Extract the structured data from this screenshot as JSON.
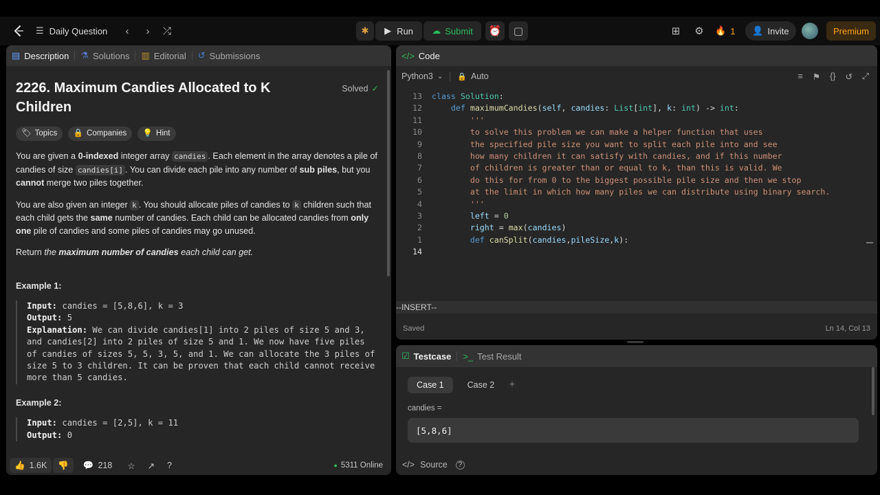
{
  "topbar": {
    "nav_label": "Daily Question",
    "run_label": "Run",
    "submit_label": "Submit",
    "streak_count": "1",
    "invite_label": "Invite",
    "premium_label": "Premium"
  },
  "desc": {
    "tabs": [
      "Description",
      "Solutions",
      "Editorial",
      "Submissions"
    ],
    "title": "2226. Maximum Candies Allocated to K Children",
    "status": "Solved",
    "chips": [
      "Topics",
      "Companies",
      "Hint"
    ],
    "p1": {
      "a": "You are given a ",
      "b": "0-indexed",
      "c": " integer array ",
      "code1": "candies",
      "d": ". Each element in the array denotes a pile of candies of size ",
      "code2": "candies[i]",
      "e": ". You can divide each pile into any number of ",
      "f": "sub piles",
      "g": ", but you ",
      "h": "cannot",
      "i": " merge two piles together."
    },
    "p2": {
      "a": "You are also given an integer ",
      "code1": "k",
      "b": ". You should allocate piles of candies to ",
      "code2": "k",
      "c": " children such that each child gets the ",
      "d": "same",
      "e": " number of candies. Each child can be allocated candies from ",
      "f": "only one",
      "g": " pile of candies and some piles of candies may go unused."
    },
    "p3": {
      "a": "Return ",
      "b": "the ",
      "c": "maximum number of candies",
      "d": " each child can get."
    },
    "example1": {
      "heading": "Example 1:",
      "input_label": "Input:",
      "input": "candies = [5,8,6], k = 3",
      "output_label": "Output:",
      "output": "5",
      "explanation_label": "Explanation:",
      "explanation_lines": [
        " We can divide candies[1] into 2 piles of size 5 and 3,",
        "and candies[2] into 2 piles of size 5 and 1. We now have five piles",
        "of candies of sizes 5, 5, 3, 5, and 1. We can allocate the 3 piles of",
        "size 5 to 3 children. It can be proven that each child cannot receive",
        "more than 5 candies."
      ]
    },
    "example2": {
      "heading": "Example 2:",
      "input_label": "Input:",
      "input": "candies = [2,5], k = 11",
      "output_label": "Output:",
      "output": "0"
    },
    "footer": {
      "likes": "1.6K",
      "comments": "218",
      "online": "5311 Online"
    }
  },
  "code": {
    "header": "Code",
    "language": "Python3",
    "autocomplete": "Auto",
    "lines": [
      {
        "n": "13",
        "t": "class Solution:"
      },
      {
        "n": "12",
        "t": "    def maximumCandies(self, candies: List[int], k: int) -> int:"
      },
      {
        "n": "11",
        "t": "        '''"
      },
      {
        "n": "10",
        "t": "        to solve this problem we can make a helper function that uses"
      },
      {
        "n": "9",
        "t": "        the specified pile size you want to split each pile into and see"
      },
      {
        "n": "8",
        "t": "        how many children it can satisfy with candies, and if this number"
      },
      {
        "n": "7",
        "t": "        of children is greater than or equal to k, than this is valid. We"
      },
      {
        "n": "6",
        "t": "        do this for from 0 to the biggest possible pile size and then we stop"
      },
      {
        "n": "5",
        "t": "        at the limit in which how many piles we can distribute using binary search."
      },
      {
        "n": "4",
        "t": "        '''"
      },
      {
        "n": "3",
        "t": "        left = 0"
      },
      {
        "n": "2",
        "t": "        right = max(candies)"
      },
      {
        "n": "1",
        "t": "        def canSplit(candies,pileSize,k):"
      },
      {
        "n": "14",
        "t": ""
      }
    ],
    "mode": "--INSERT--",
    "saved": "Saved",
    "cursor": "Ln 14, Col 13"
  },
  "tests": {
    "tab_testcase": "Testcase",
    "tab_result": "Test Result",
    "cases": [
      "Case 1",
      "Case 2"
    ],
    "add": "+",
    "param_label": "candies =",
    "param_value": "[5,8,6]",
    "source_label": "Source"
  },
  "colors": {
    "accent_green": "#2cbb5d",
    "premium": "#ffa116",
    "fire": "#ff7a1a"
  }
}
